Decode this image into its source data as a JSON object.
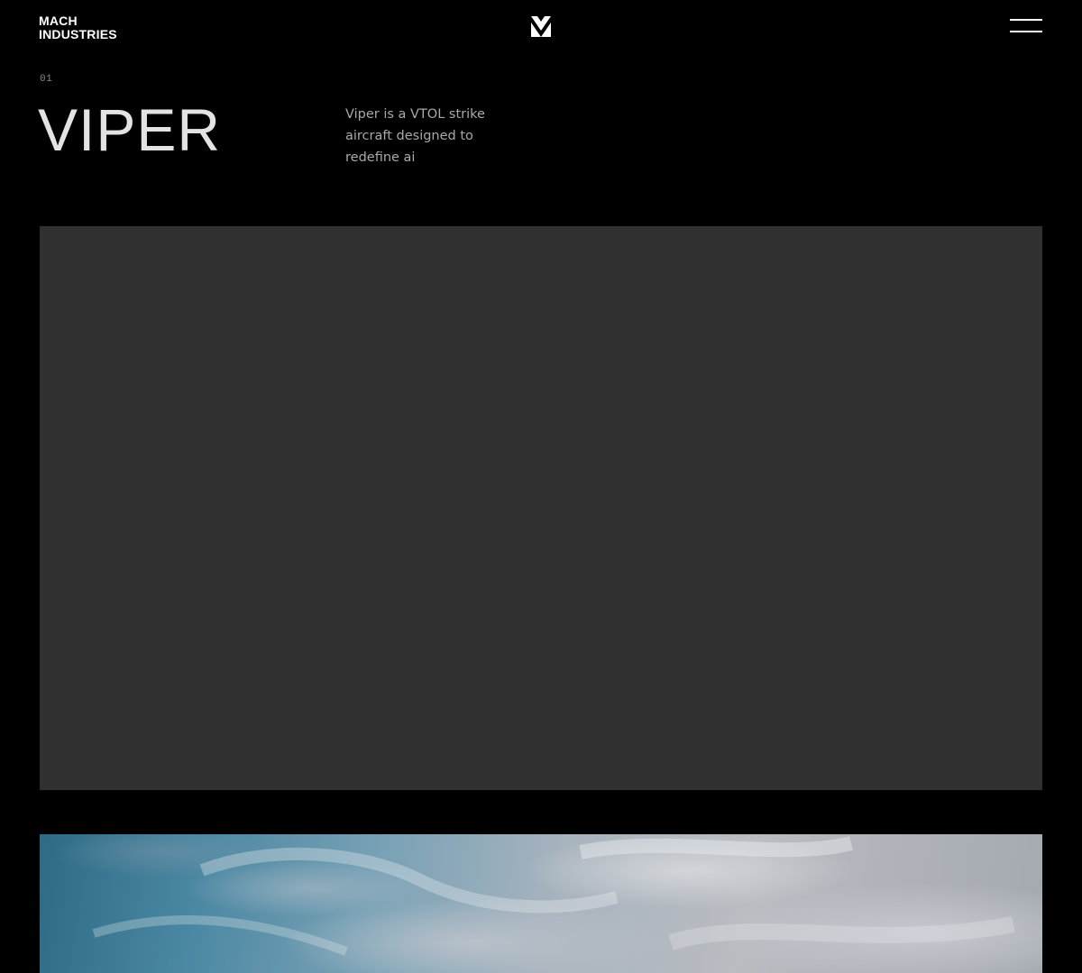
{
  "header": {
    "brand_line1": "MACH",
    "brand_line2": "INDUSTRIES",
    "logo_icon": "mach-chevron-logo-icon",
    "menu_icon": "hamburger-menu-icon",
    "menu_label": "Menu"
  },
  "hero": {
    "index": "01",
    "title": "VIPER",
    "description": "Viper is a VTOL strike aircraft designed to redefine ai"
  },
  "colors": {
    "background": "#000000",
    "title": "#e3e3e3",
    "body_text": "#a9a9a9",
    "media_placeholder": "#303030"
  }
}
